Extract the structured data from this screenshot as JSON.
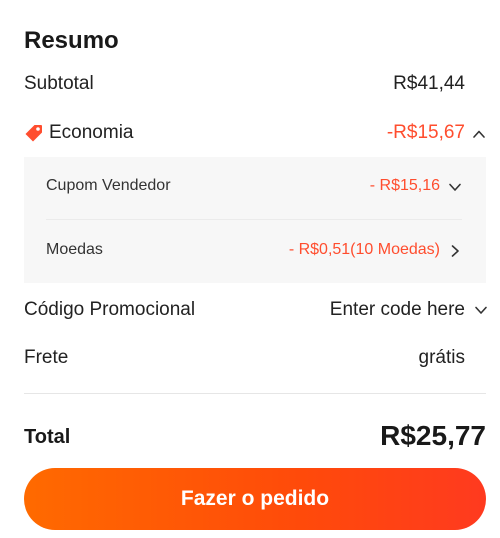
{
  "summary": {
    "title": "Resumo",
    "subtotal": {
      "label": "Subtotal",
      "value": "R$41,44"
    },
    "savings": {
      "label": "Economia",
      "value": "-R$15,67",
      "icon": "tag-icon",
      "accent_color": "#ff4d2e",
      "expanded": true,
      "items": [
        {
          "label": "Cupom Vendedor",
          "value": "- R$15,16",
          "chevron": "chevron-down-icon"
        },
        {
          "label": "Moedas",
          "value": "- R$0,51(10 Moedas)",
          "chevron": "chevron-right-icon"
        }
      ]
    },
    "promo": {
      "label": "Código Promocional",
      "value": "Enter code here"
    },
    "shipping": {
      "label": "Frete",
      "value": "grátis"
    },
    "total": {
      "label": "Total",
      "value": "R$25,77"
    }
  },
  "actions": {
    "place_order_label": "Fazer o pedido",
    "button_gradient": [
      "#ff6a00",
      "#ff3a1f"
    ]
  }
}
